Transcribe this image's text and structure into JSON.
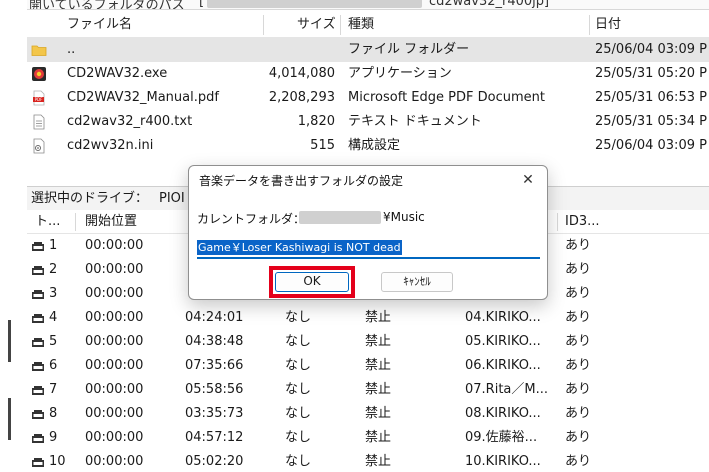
{
  "path_bar": {
    "label": "開いているフォルダのパス",
    "bracket": "[",
    "path_suffix": "cd2wav32_r400jp]"
  },
  "file_list": {
    "headers": {
      "name": "ファイル名",
      "size": "サイズ",
      "type": "種類",
      "date": "日付"
    },
    "rows": [
      {
        "icon": "folder-icon",
        "name": "..",
        "size": "",
        "type": "ファイル フォルダー",
        "date": "25/06/04 03:09 P"
      },
      {
        "icon": "app-icon",
        "name": "CD2WAV32.exe",
        "size": "4,014,080",
        "type": "アプリケーション",
        "date": "25/05/31 05:20 P"
      },
      {
        "icon": "pdf-icon",
        "name": "CD2WAV32_Manual.pdf",
        "size": "2,208,293",
        "type": "Microsoft Edge PDF Document",
        "date": "25/05/31 06:53 P"
      },
      {
        "icon": "text-file-icon",
        "name": "cd2wav32_r400.txt",
        "size": "1,820",
        "type": "テキスト ドキュメント",
        "date": "25/05/31 05:34 P"
      },
      {
        "icon": "config-file-icon",
        "name": "cd2wv32n.ini",
        "size": "515",
        "type": "構成設定",
        "date": "25/06/04 03:09 P"
      }
    ]
  },
  "drive_bar": {
    "label": "選択中のドライブ：",
    "value": "PIOI"
  },
  "track_list": {
    "headers": {
      "track": "ト...",
      "start": "開始位置",
      "id3": "ID3..."
    },
    "rows": [
      {
        "no": "1",
        "start": "00:00:00",
        "length": "",
        "flag1": "",
        "flag2": "",
        "title": "",
        "id3": "あり"
      },
      {
        "no": "2",
        "start": "00:00:00",
        "length": "",
        "flag1": "",
        "flag2": "",
        "title": "",
        "id3": "あり"
      },
      {
        "no": "3",
        "start": "00:00:00",
        "length": "",
        "flag1": "",
        "flag2": "",
        "title": "",
        "id3": "あり"
      },
      {
        "no": "4",
        "start": "00:00:00",
        "length": "04:24:01",
        "flag1": "なし",
        "flag2": "禁止",
        "title": "04.KIRIKO...",
        "id3": "あり"
      },
      {
        "no": "5",
        "start": "00:00:00",
        "length": "04:38:48",
        "flag1": "なし",
        "flag2": "禁止",
        "title": "05.KIRIKO...",
        "id3": "あり"
      },
      {
        "no": "6",
        "start": "00:00:00",
        "length": "07:35:66",
        "flag1": "なし",
        "flag2": "禁止",
        "title": "06.KIRIKO...",
        "id3": "あり"
      },
      {
        "no": "7",
        "start": "00:00:00",
        "length": "05:58:56",
        "flag1": "なし",
        "flag2": "禁止",
        "title": "07.Rita／M...",
        "id3": "あり"
      },
      {
        "no": "8",
        "start": "00:00:00",
        "length": "03:35:73",
        "flag1": "なし",
        "flag2": "禁止",
        "title": "08.KIRIKO...",
        "id3": "あり"
      },
      {
        "no": "9",
        "start": "00:00:00",
        "length": "04:57:12",
        "flag1": "なし",
        "flag2": "禁止",
        "title": "09.佐藤裕...",
        "id3": "あり"
      },
      {
        "no": "10",
        "start": "00:00:00",
        "length": "05:02:20",
        "flag1": "なし",
        "flag2": "禁止",
        "title": "10.KIRIKO...",
        "id3": "あり"
      }
    ]
  },
  "dialog": {
    "title": "音楽データを書き出すフォルダの設定",
    "close": "✕",
    "current_label": "カレントフォルダ：",
    "current_suffix": "¥Music",
    "input_value": "Game￥Loser Kashiwagi is NOT dead",
    "ok_label": "OK",
    "cancel_label": "ｷｬﾝｾﾙ"
  },
  "colors": {
    "selection": "#0a64c8",
    "highlight_box": "#e4001b",
    "focus_border": "#0067c0"
  }
}
